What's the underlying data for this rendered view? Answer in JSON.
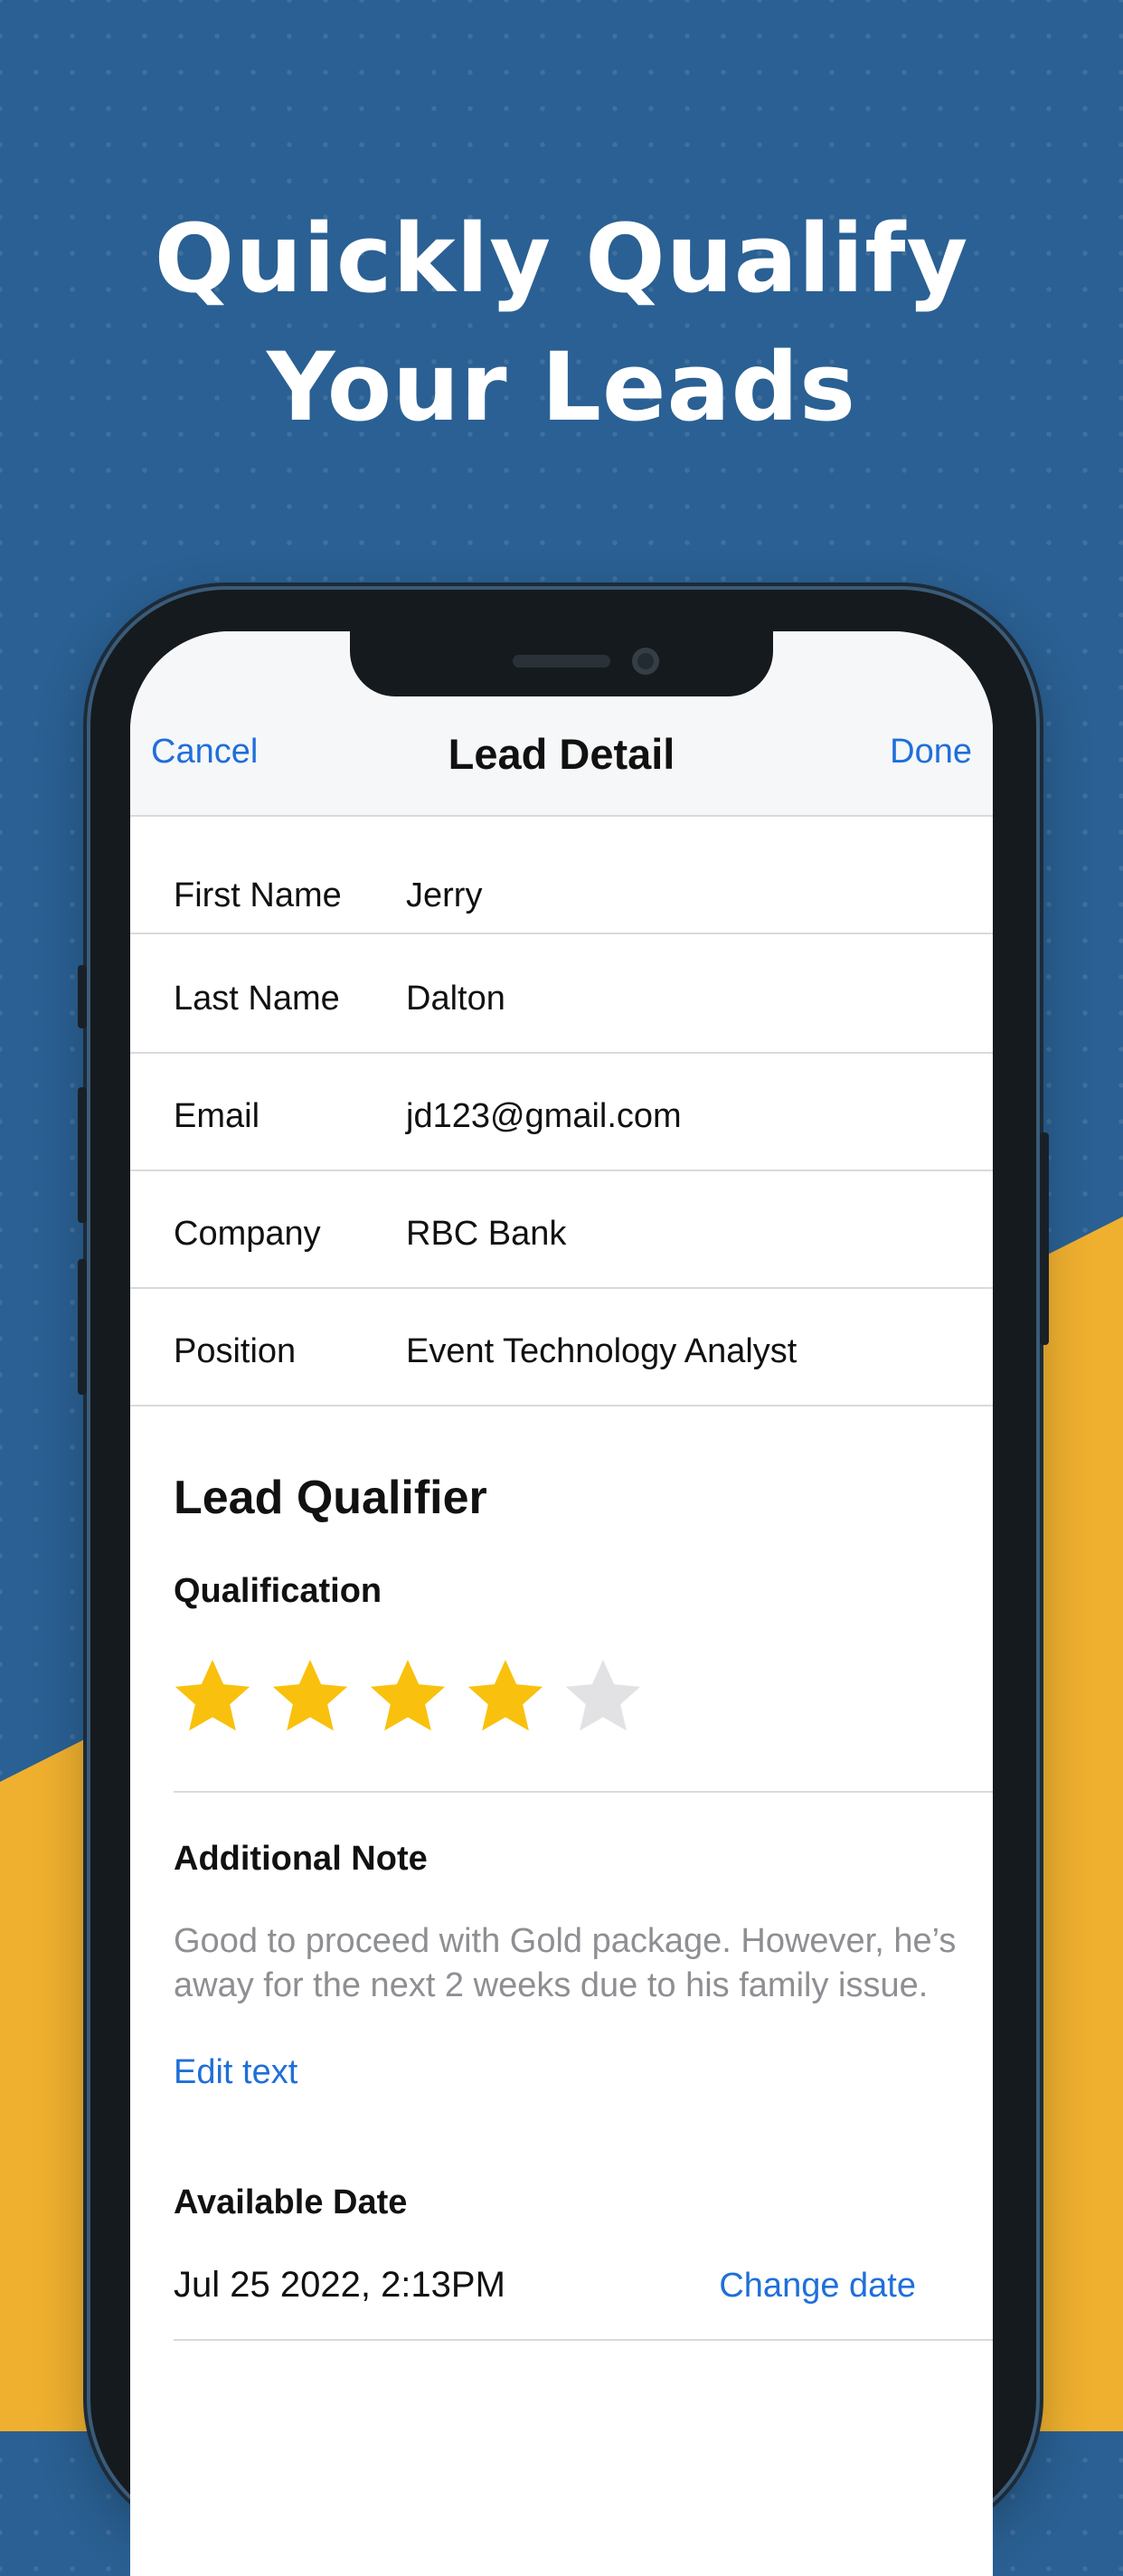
{
  "headline": {
    "line1": "Quickly Qualify",
    "line2": "Your Leads"
  },
  "navbar": {
    "cancel_label": "Cancel",
    "title": "Lead Detail",
    "done_label": "Done"
  },
  "fields": [
    {
      "label": "First Name",
      "value": "Jerry"
    },
    {
      "label": "Last Name",
      "value": "Dalton"
    },
    {
      "label": "Email",
      "value": "jd123@gmail.com"
    },
    {
      "label": "Company",
      "value": "RBC Bank"
    },
    {
      "label": "Position",
      "value": "Event Technology Analyst"
    }
  ],
  "qualifier": {
    "title": "Lead Qualifier",
    "qualification_label": "Qualification",
    "rating": 4,
    "max_rating": 5,
    "note_label": "Additional Note",
    "note_text": "Good to proceed with Gold package. However, he’s away for the next 2 weeks due to his family issue.",
    "edit_label": "Edit text",
    "date_label": "Available Date",
    "date_value": "Jul 25 2022, 2:13PM",
    "change_date_label": "Change date"
  },
  "colors": {
    "background_blue": "#2a6093",
    "accent_yellow": "#efb02f",
    "link_blue": "#1f6fd9",
    "star_filled": "#f9c10d",
    "star_empty": "#e2e2e4"
  },
  "icons": {
    "star": "star-icon"
  }
}
